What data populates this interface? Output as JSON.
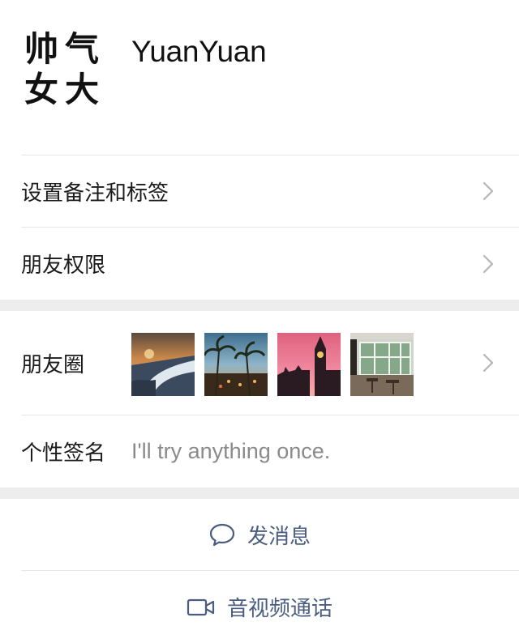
{
  "profile": {
    "avatar_chars": [
      "帅",
      "气",
      "女",
      "大"
    ],
    "nickname": "YuanYuan"
  },
  "menu": {
    "remark_tags": "设置备注和标签",
    "friend_permissions": "朋友权限"
  },
  "moments": {
    "label": "朋友圈",
    "photos": [
      {
        "icon": "waterfall-photo"
      },
      {
        "icon": "palm-tree-sunset-photo"
      },
      {
        "icon": "big-ben-sunset-photo"
      },
      {
        "icon": "cafe-interior-photo"
      }
    ]
  },
  "signature": {
    "label": "个性签名",
    "value": "I'll try anything once."
  },
  "actions": {
    "send_message": "发消息",
    "video_call": "音视频通话"
  },
  "colors": {
    "accent_text": "#4a5d80",
    "separator": "#ededed",
    "chevron": "#b5b5b5"
  },
  "icons": {
    "row_chevron": "chevron-right-icon",
    "message": "chat-bubble-icon",
    "video": "video-camera-icon"
  }
}
